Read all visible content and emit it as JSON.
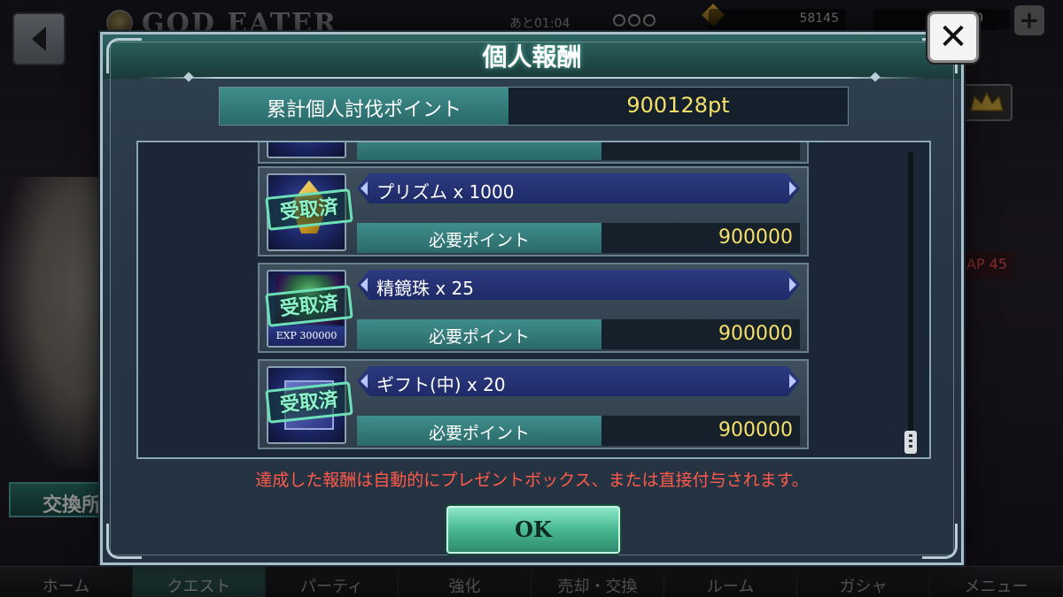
{
  "background": {
    "timer": "あと01:04",
    "coins": "58145",
    "gems": "420",
    "plus_label": "+",
    "exchange_label": "交換所",
    "ap_label": "AP 45",
    "nav": [
      "ホーム",
      "クエスト",
      "パーティ",
      "強化",
      "売却・交換",
      "ルーム",
      "ガシャ",
      "メニュー"
    ],
    "nav_active_index": 1
  },
  "modal": {
    "title": "個人報酬",
    "total_label": "累計個人討伐ポイント",
    "total_value": "900128pt",
    "rewards": [
      {
        "name": "プリズム x 1000",
        "icon": "prism-icon",
        "stamp": "受取済",
        "req_label": "必要ポイント",
        "req_value": "900000"
      },
      {
        "name": "精鏡珠 x 25",
        "icon": "mirror-orb-icon",
        "icon_caption": "EXP 300000",
        "stamp": "受取済",
        "req_label": "必要ポイント",
        "req_value": "900000"
      },
      {
        "name": "ギフト(中) x 20",
        "icon": "gift-icon",
        "stamp": "受取済",
        "req_label": "必要ポイント",
        "req_value": "900000"
      }
    ],
    "notice": "達成した報酬は自動的にプレゼントボックス、または直接付与されます。",
    "ok_label": "OK",
    "close_label": "✕"
  }
}
